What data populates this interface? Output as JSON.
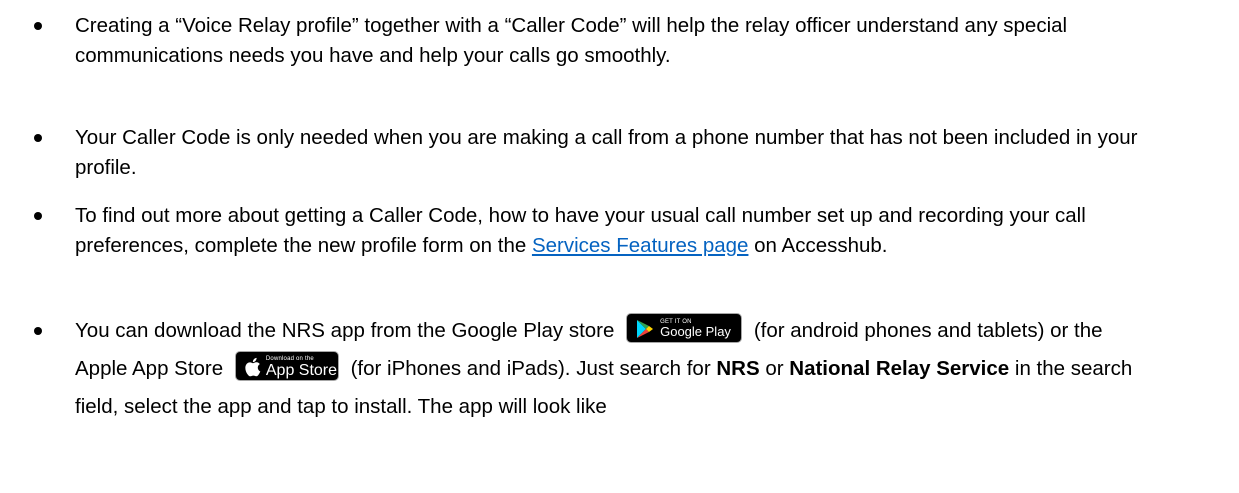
{
  "bullets": {
    "b1": {
      "text": "Creating a “Voice Relay profile” together with a “Caller Code” will help the relay officer understand any special communications needs you have and help your calls go smoothly."
    },
    "b2": {
      "text": "Your Caller Code is only needed when you are making a call from a phone number that has not been included in your profile."
    },
    "b3": {
      "text_before": "To find out more about getting a Caller Code, how to have your usual call number set up and recording your call preferences, complete the new profile form on the ",
      "link_text": "Services Features page",
      "text_after": " on Accesshub."
    },
    "b4": {
      "text_1": "You can download the NRS app from the Google Play store",
      "text_2": "(for android phones and tablets) or the Apple App Store",
      "text_3": "(for iPhones and iPads). Just search for ",
      "bold_1": "NRS",
      "text_4": " or ",
      "bold_2": "National Relay Service",
      "text_5": " in the search field, select the app and tap to install. The app will look like"
    }
  },
  "google_play_badge": {
    "small_text": "GET IT ON",
    "big_text": "Google Play",
    "icon": "google-play-icon"
  },
  "app_store_badge": {
    "small_text": "Download on the",
    "big_text": "App Store",
    "icon": "apple-icon"
  },
  "colors": {
    "link": "#0563c1",
    "text": "#000000",
    "badge_bg": "#000000"
  }
}
